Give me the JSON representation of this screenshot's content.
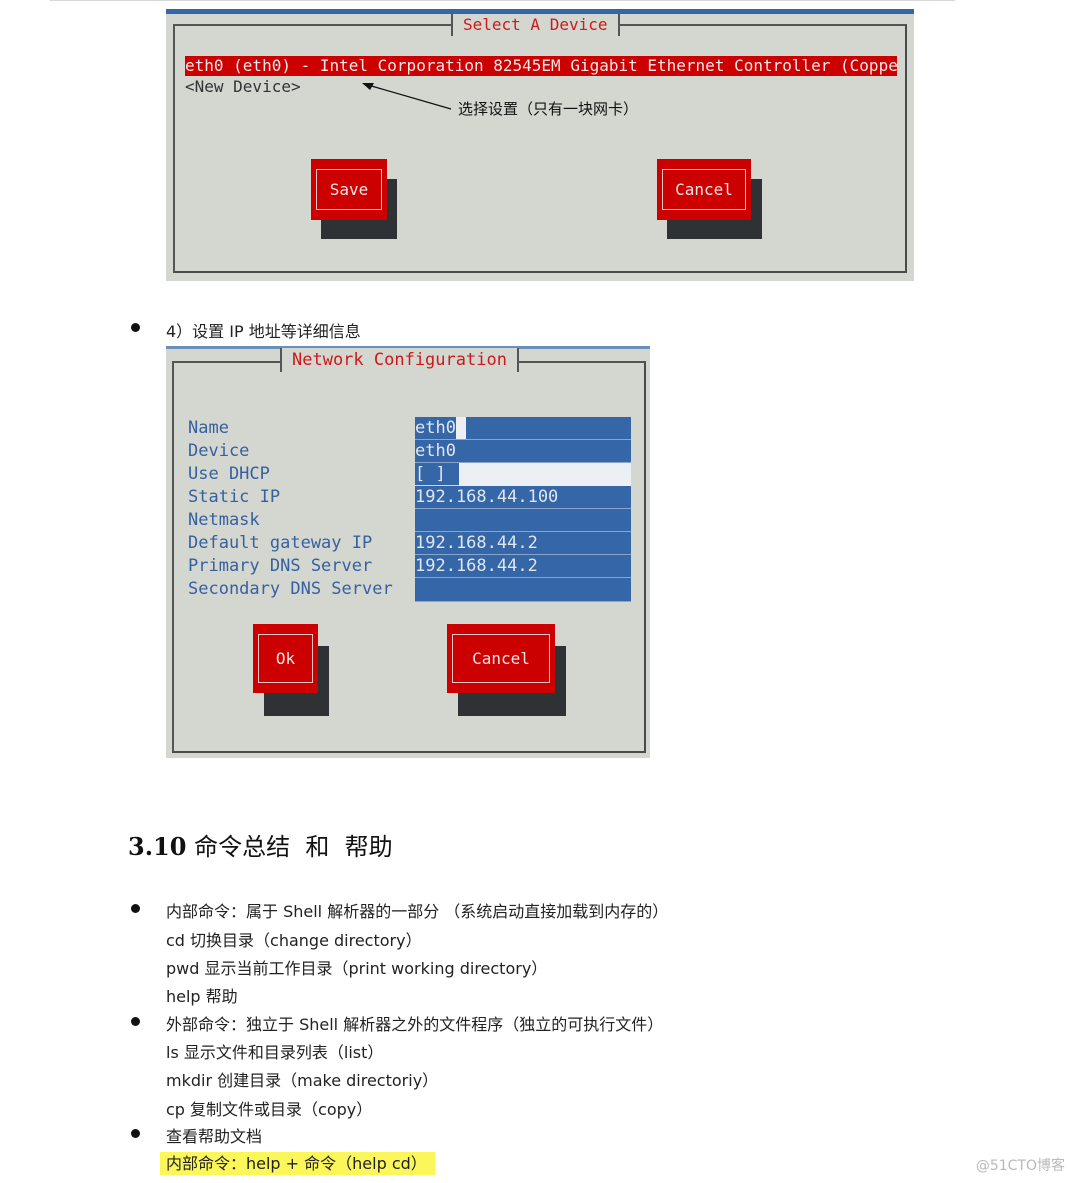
{
  "dialog_select_device": {
    "title": "Select A Device",
    "devices": [
      {
        "label": "eth0 (eth0) - Intel Corporation 82545EM Gigabit Ethernet Controller (Coppe",
        "selected": true
      },
      {
        "label": "<New Device>",
        "selected": false
      }
    ],
    "annotation": "选择设置（只有一块网卡）",
    "buttons": {
      "save": "Save",
      "cancel": "Cancel"
    }
  },
  "step4": {
    "label": "4）设置 IP 地址等详细信息"
  },
  "dialog_network_config": {
    "title": "Network Configuration",
    "fields": [
      {
        "label": "Name",
        "value": "eth0"
      },
      {
        "label": "Device",
        "value": "eth0"
      },
      {
        "label": "Use DHCP",
        "value": "[ ]"
      },
      {
        "label": "Static IP",
        "value": "192.168.44.100"
      },
      {
        "label": "Netmask",
        "value": ""
      },
      {
        "label": "Default gateway IP",
        "value": "192.168.44.2"
      },
      {
        "label": "Primary DNS Server",
        "value": "192.168.44.2"
      },
      {
        "label": "Secondary DNS Server",
        "value": ""
      }
    ],
    "buttons": {
      "ok": "Ok",
      "cancel": "Cancel"
    }
  },
  "section": {
    "number": "3.10",
    "title": "命令总结  和  帮助"
  },
  "bullets": [
    {
      "text": "内部命令：属于 Shell 解析器的一部分 （系统启动直接加载到内存的）",
      "sub": [
        "cd  切换目录（change directory）",
        "pwd  显示当前工作目录（print working directory）",
        "help  帮助"
      ]
    },
    {
      "text": "外部命令：独立于 Shell 解析器之外的文件程序（独立的可执行文件）",
      "sub": [
        "ls  显示文件和目录列表（list）",
        "mkdir  创建目录（make directoriy）",
        "cp  复制文件或目录（copy）"
      ]
    },
    {
      "text": "查看帮助文档",
      "sub": [
        "内部命令：help +  命令（help cd）"
      ]
    }
  ],
  "watermark": "@51CTO博客",
  "colors": {
    "tui_bg": "#d4d6d0",
    "tui_red": "#cc0000",
    "tui_blue": "#3566a8",
    "label_blue": "#3561a0",
    "highlight_yellow": "#fbf65a"
  }
}
